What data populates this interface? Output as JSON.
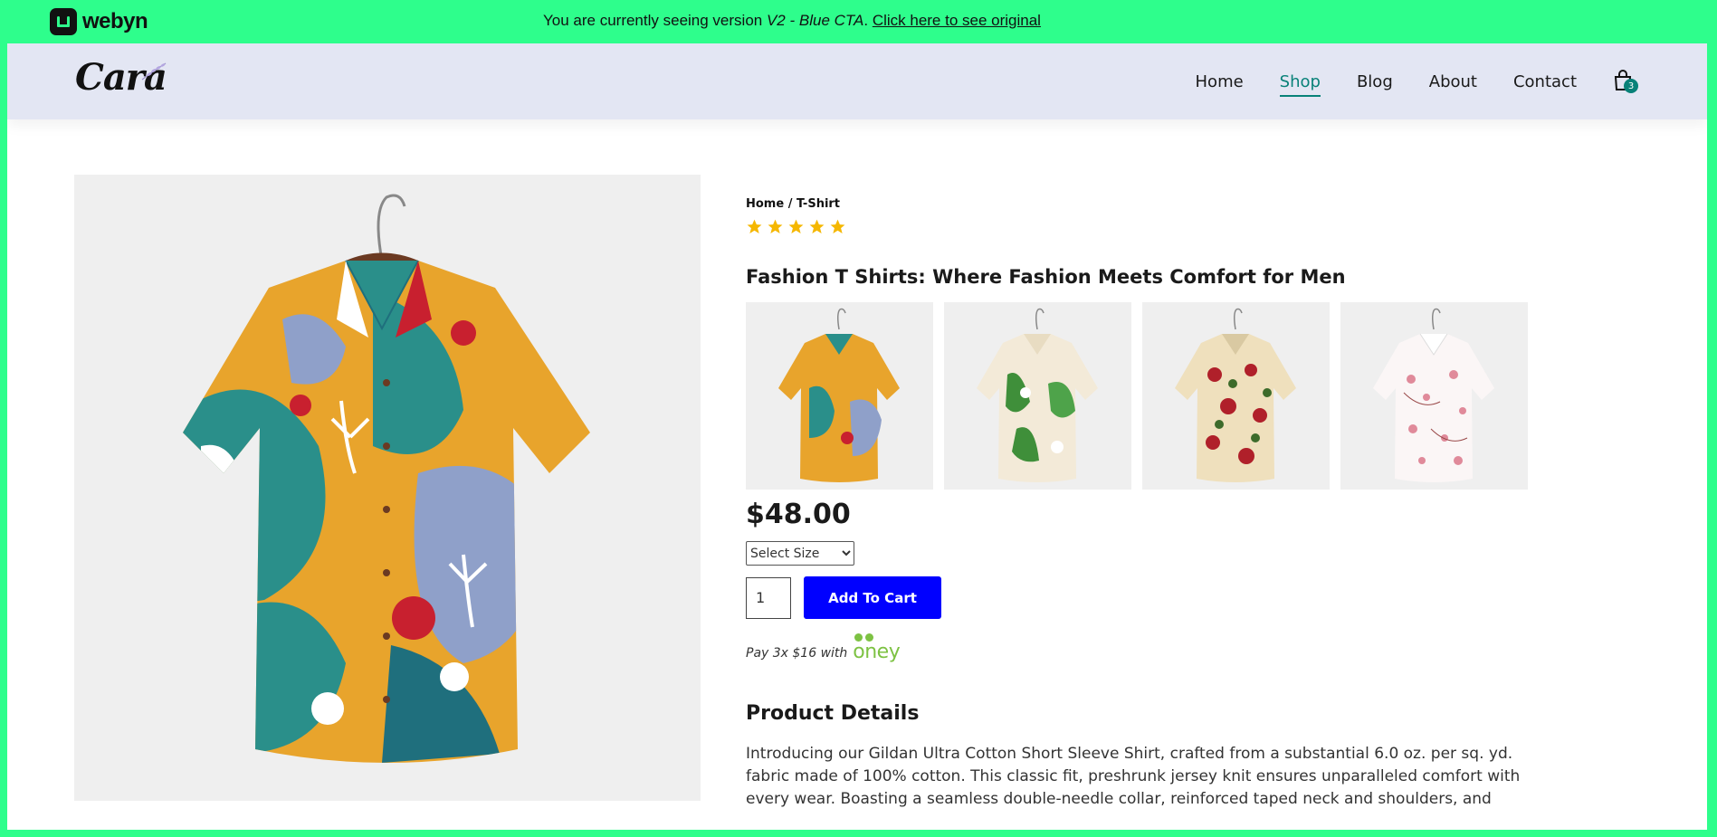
{
  "topbar": {
    "brand": "webyn",
    "banner_prefix": "You are currently seeing version ",
    "banner_version": "V2 - Blue CTA",
    "banner_suffix": ". ",
    "banner_link": "Click here to see original"
  },
  "site": {
    "logo": "Cara",
    "nav": [
      {
        "label": "Home"
      },
      {
        "label": "Shop"
      },
      {
        "label": "Blog"
      },
      {
        "label": "About"
      },
      {
        "label": "Contact"
      }
    ],
    "active_nav": "Shop",
    "cart_count": "3"
  },
  "product": {
    "breadcrumb": "Home / T-Shirt",
    "rating": 5,
    "rating_max": 5,
    "title": "Fashion T Shirts: Where Fashion Meets Comfort for Men",
    "price": "$48.00",
    "size_select": {
      "selected": "Select Size",
      "options": [
        "Select Size"
      ]
    },
    "quantity": "1",
    "add_to_cart": "Add To Cart",
    "pay_text": "Pay 3x $16 with",
    "pay_provider": "oney",
    "details_title": "Product Details",
    "details_text": "Introducing our Gildan Ultra Cotton Short Sleeve Shirt, crafted from a substantial 6.0 oz. per sq. yd. fabric made of 100% cotton. This classic fit, preshrunk jersey knit ensures unparalleled comfort with every wear. Boasting a seamless double-needle collar, reinforced taped neck and shoulders, and"
  },
  "colors": {
    "banner": "#2efe8c",
    "header_bg": "#e3e6f3",
    "accent": "#088178",
    "cta": "#0000ff",
    "star": "#f5b700",
    "oney": "#7dc243"
  },
  "images": {
    "main": "floral-shirt-orange-teal",
    "thumbnails": [
      "floral-shirt-orange-teal",
      "floral-shirt-green-leaves",
      "floral-shirt-red-beige",
      "floral-shirt-pink-white"
    ]
  }
}
